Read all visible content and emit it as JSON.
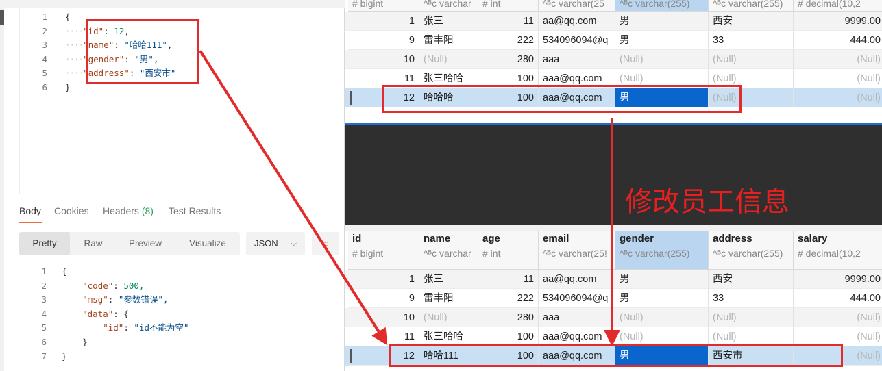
{
  "request_body": {
    "lines": [
      {
        "n": "1",
        "code": "{"
      },
      {
        "n": "2",
        "key": "\"id\"",
        "val": "12",
        "vtype": "num"
      },
      {
        "n": "3",
        "key": "\"name\"",
        "val": "\"哈哈111\"",
        "vtype": "str"
      },
      {
        "n": "4",
        "key": "\"gender\"",
        "val": "\"男\"",
        "vtype": "str"
      },
      {
        "n": "5",
        "key": "\"address\"",
        "val": "\"西安市\"",
        "vtype": "str"
      },
      {
        "n": "6",
        "code": "}"
      }
    ]
  },
  "response_tabs": {
    "body": "Body",
    "cookies": "Cookies",
    "headers": "Headers",
    "headers_count": "(8)",
    "test_results": "Test Results"
  },
  "view_modes": {
    "pretty": "Pretty",
    "raw": "Raw",
    "preview": "Preview",
    "visualize": "Visualize",
    "format": "JSON",
    "wrap_icon": "wrap-lines-icon"
  },
  "response_body": {
    "lines": [
      {
        "n": "1",
        "code": "{"
      },
      {
        "n": "2",
        "key": "\"code\"",
        "val": "500,",
        "vtype": "num",
        "indent": 1
      },
      {
        "n": "3",
        "key": "\"msg\"",
        "val": "\"参数错误\",",
        "vtype": "str",
        "indent": 1
      },
      {
        "n": "4",
        "key": "\"data\"",
        "val": "{",
        "vtype": "punc",
        "indent": 1
      },
      {
        "n": "5",
        "key": "\"id\"",
        "val": "\"id不能为空\"",
        "vtype": "str",
        "indent": 2
      },
      {
        "n": "6",
        "code": "}",
        "indent": 1
      },
      {
        "n": "7",
        "code": "}"
      }
    ]
  },
  "table_top": {
    "types": [
      "bigint",
      "varchar",
      "int",
      "varchar(25",
      "varchar(255)",
      "varchar(255)",
      "decimal(10,2"
    ],
    "rows": [
      [
        "1",
        "张三",
        "11",
        "aa@qq.com",
        "男",
        "西安",
        "9999.00"
      ],
      [
        "9",
        "雷丰阳",
        "222",
        "534096094@q",
        "男",
        "33",
        "444.00"
      ],
      [
        "10",
        "(Null)",
        "280",
        "aaa",
        "(Null)",
        "(Null)",
        "(Null)"
      ],
      [
        "11",
        "张三哈哈",
        "100",
        "aaa@qq.com",
        "(Null)",
        "(Null)",
        "(Null)"
      ],
      [
        "12",
        "哈哈哈",
        "100",
        "aaa@qq.com",
        "男",
        "(Null)",
        "(Null)"
      ]
    ]
  },
  "table_bottom": {
    "columns": [
      "id",
      "name",
      "age",
      "email",
      "gender",
      "address",
      "salary"
    ],
    "types": [
      "bigint",
      "varchar",
      "int",
      "varchar(25!",
      "varchar(255)",
      "varchar(255)",
      "decimal(10,2"
    ],
    "rows": [
      [
        "1",
        "张三",
        "11",
        "aa@qq.com",
        "男",
        "西安",
        "9999.00"
      ],
      [
        "9",
        "雷丰阳",
        "222",
        "534096094@q",
        "男",
        "33",
        "444.00"
      ],
      [
        "10",
        "(Null)",
        "280",
        "aaa",
        "(Null)",
        "(Null)",
        "(Null)"
      ],
      [
        "11",
        "张三哈哈",
        "100",
        "aaa@qq.com",
        "(Null)",
        "(Null)",
        "(Null)"
      ],
      [
        "12",
        "哈哈111",
        "100",
        "aaa@qq.com",
        "男",
        "西安市",
        "(Null)"
      ]
    ]
  },
  "annotation": {
    "label": "修改员工信息",
    "color": "#e62020"
  }
}
